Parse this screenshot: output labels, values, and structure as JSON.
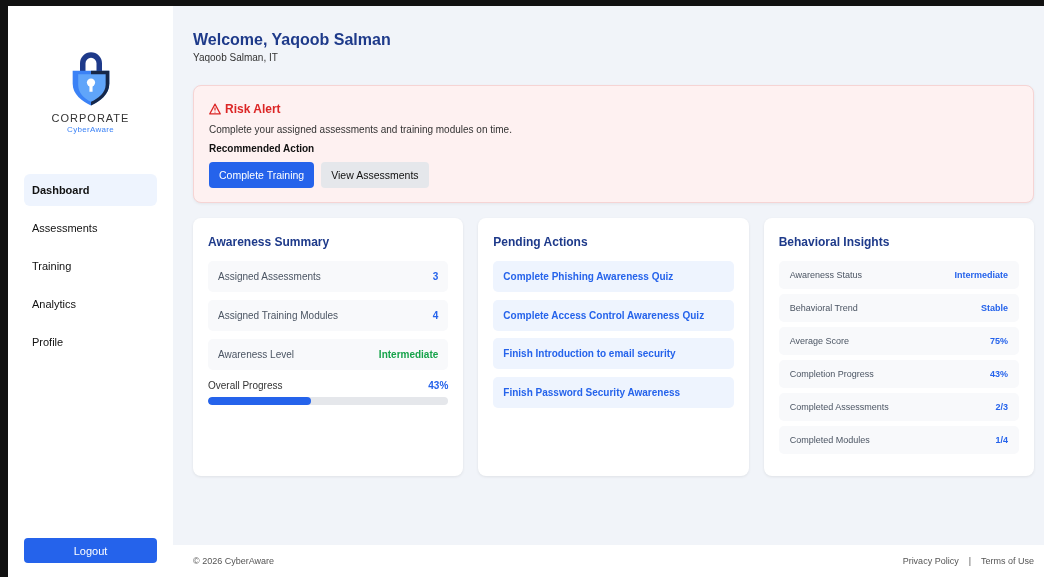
{
  "sidebar": {
    "logo": {
      "title": "CORPORATE",
      "subtitle": "CyberAware"
    },
    "items": [
      {
        "label": "Dashboard",
        "selected": true
      },
      {
        "label": "Assessments",
        "selected": false
      },
      {
        "label": "Training",
        "selected": false
      },
      {
        "label": "Analytics",
        "selected": false
      },
      {
        "label": "Profile",
        "selected": false
      }
    ],
    "logout": "Logout"
  },
  "header": {
    "title": "Welcome, Yaqoob Salman",
    "subtitle": "Yaqoob Salman, IT"
  },
  "alert": {
    "title": "Risk Alert",
    "message": "Complete your assigned assessments and training modules on time.",
    "action_label": "Recommended Action",
    "buttons": [
      {
        "label": "Complete Training",
        "kind": "primary"
      },
      {
        "label": "View Assessments",
        "kind": "secondary"
      }
    ]
  },
  "summary": {
    "title": "Awareness Summary",
    "rows": [
      {
        "label": "Assigned Assessments",
        "value": "3",
        "color": "#2563eb"
      },
      {
        "label": "Assigned Training Modules",
        "value": "4",
        "color": "#2563eb"
      },
      {
        "label": "Awareness Level",
        "value": "Intermediate",
        "color": "#16a34a"
      }
    ],
    "progress": {
      "label": "Overall Progress",
      "reading": "43%",
      "level": 0.43
    }
  },
  "pending": {
    "title": "Pending Actions",
    "items": [
      "Complete Phishing Awareness Quiz",
      "Complete Access Control Awareness Quiz",
      "Finish Introduction to email security",
      "Finish Password Security Awareness"
    ]
  },
  "insights": {
    "title": "Behavioral Insights",
    "rows": [
      {
        "label": "Awareness Status",
        "value": "Intermediate"
      },
      {
        "label": "Behavioral Trend",
        "value": "Stable"
      },
      {
        "label": "Average Score",
        "value": "75%"
      },
      {
        "label": "Completion Progress",
        "value": "43%"
      },
      {
        "label": "Completed Assessments",
        "value": "2/3"
      },
      {
        "label": "Completed Modules",
        "value": "1/4"
      }
    ]
  },
  "footer": {
    "copyright": "© 2026 CyberAware",
    "links": [
      "Privacy Policy",
      "Terms of Use"
    ],
    "separator": "|"
  }
}
